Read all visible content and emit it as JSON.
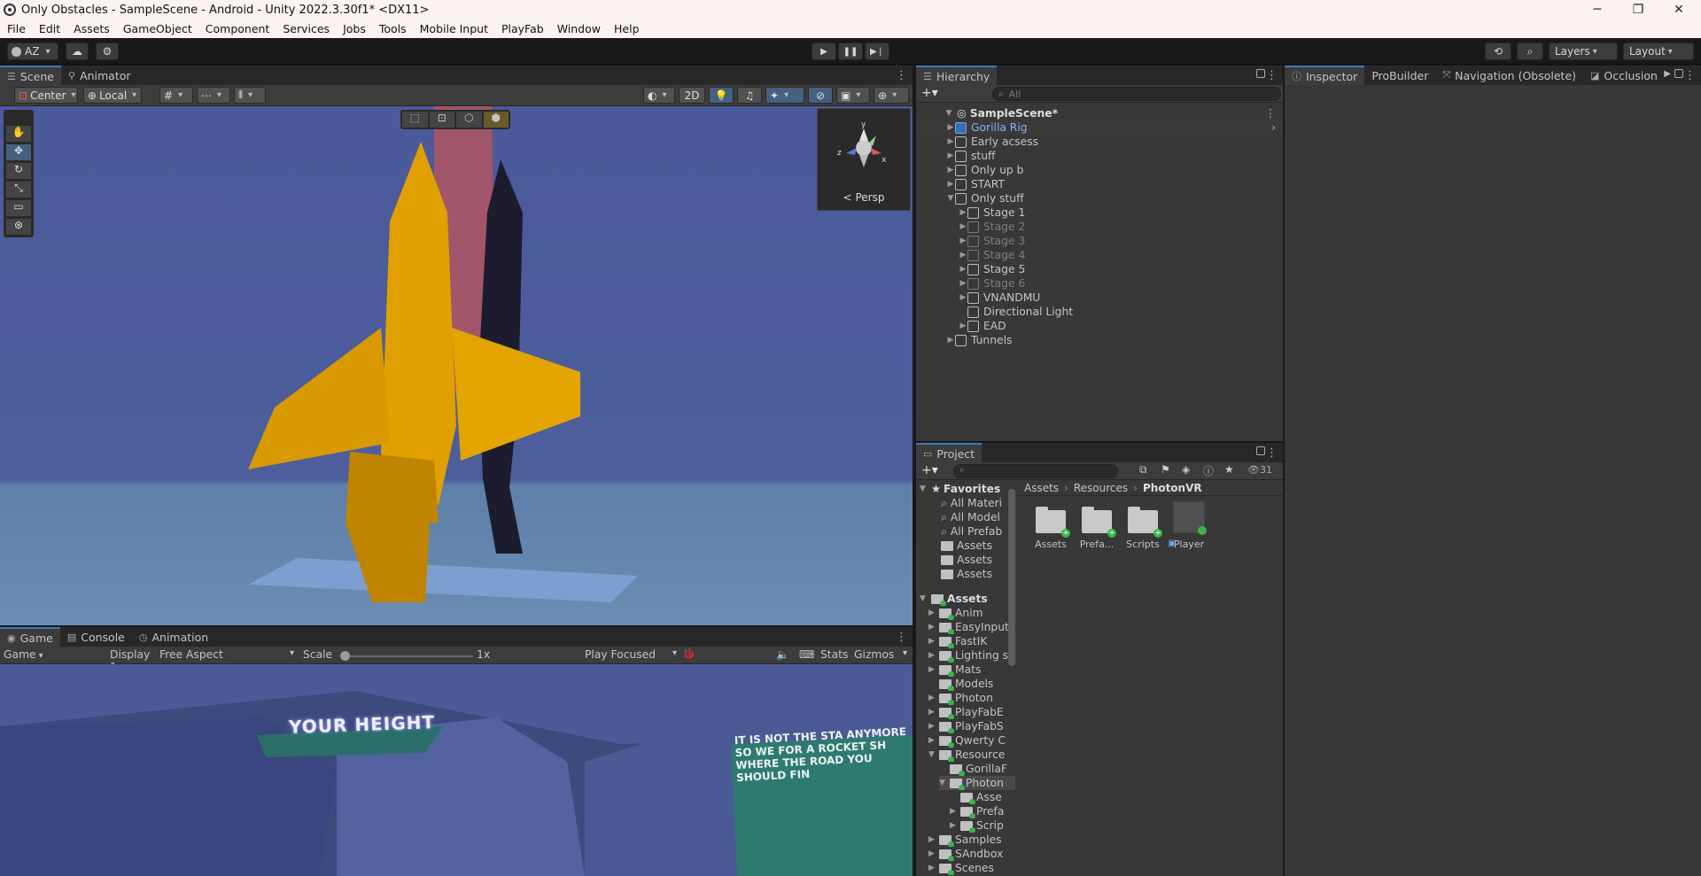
{
  "window": {
    "title": "Only Obstacles - SampleScene - Android - Unity 2022.3.30f1* <DX11>",
    "minimize": "─",
    "maximize": "❐",
    "close": "✕"
  },
  "menu": [
    "File",
    "Edit",
    "Assets",
    "GameObject",
    "Component",
    "Services",
    "Jobs",
    "Tools",
    "Mobile Input",
    "PlayFab",
    "Window",
    "Help"
  ],
  "toolbar": {
    "account": "AZ",
    "layers": "Layers",
    "layout": "Layout"
  },
  "scene_panel": {
    "tabs": [
      "Scene",
      "Animator"
    ],
    "pivot": "Center",
    "space": "Local",
    "mode_2d": "2D",
    "persp": "Persp",
    "gizmo_axes": {
      "y": "y",
      "x": "x",
      "z": "z"
    }
  },
  "game_panel": {
    "tabs": [
      "Game",
      "Console",
      "Animation"
    ],
    "display_mode": "Game",
    "display": "Display 1",
    "aspect": "Free Aspect",
    "scale_label": "Scale",
    "scale_value": "1x",
    "play_mode": "Play Focused",
    "stats": "Stats",
    "gizmos": "Gizmos",
    "scene_text_1": "YOUR HEIGHT",
    "scene_text_2": "IT IS NOT THE STA ANYMORE SO WE FOR A ROCKET SH WHERE THE ROAD YOU SHOULD FIN"
  },
  "hierarchy": {
    "tab": "Hierarchy",
    "search_placeholder": "All",
    "scene": "SampleScene*",
    "items": [
      {
        "label": "Gorilla Rig",
        "depth": 1,
        "arrow": "▶",
        "style": "blue"
      },
      {
        "label": "Early acsess",
        "depth": 1,
        "arrow": "▶",
        "style": ""
      },
      {
        "label": "stuff",
        "depth": 1,
        "arrow": "▶",
        "style": ""
      },
      {
        "label": "Only up b",
        "depth": 1,
        "arrow": "▶",
        "style": ""
      },
      {
        "label": "START",
        "depth": 1,
        "arrow": "▶",
        "style": ""
      },
      {
        "label": "Only stuff",
        "depth": 1,
        "arrow": "▼",
        "style": ""
      },
      {
        "label": "Stage 1",
        "depth": 2,
        "arrow": "▶",
        "style": ""
      },
      {
        "label": "Stage 2",
        "depth": 2,
        "arrow": "▶",
        "style": "dim"
      },
      {
        "label": "Stage 3",
        "depth": 2,
        "arrow": "▶",
        "style": "dim"
      },
      {
        "label": "Stage 4",
        "depth": 2,
        "arrow": "▶",
        "style": "dim"
      },
      {
        "label": "Stage 5",
        "depth": 2,
        "arrow": "▶",
        "style": ""
      },
      {
        "label": "Stage 6",
        "depth": 2,
        "arrow": "▶",
        "style": "dim"
      },
      {
        "label": "VNANDMU",
        "depth": 2,
        "arrow": "▶",
        "style": ""
      },
      {
        "label": "Directional Light",
        "depth": 2,
        "arrow": "",
        "style": ""
      },
      {
        "label": "EAD",
        "depth": 2,
        "arrow": "▶",
        "style": ""
      },
      {
        "label": "Tunnels",
        "depth": 1,
        "arrow": "▶",
        "style": ""
      }
    ]
  },
  "project": {
    "tab": "Project",
    "count": "31",
    "favorites_label": "Favorites",
    "favorites": [
      "All Materi",
      "All Model",
      "All Prefab",
      "Assets",
      "Assets",
      "Assets"
    ],
    "assets_label": "Assets",
    "tree": [
      {
        "label": "Anim",
        "depth": 1,
        "arrow": "▶"
      },
      {
        "label": "EasyInput",
        "depth": 1,
        "arrow": "▶"
      },
      {
        "label": "FastIK",
        "depth": 1,
        "arrow": "▶"
      },
      {
        "label": "Lighting s",
        "depth": 1,
        "arrow": "▶"
      },
      {
        "label": "Mats",
        "depth": 1,
        "arrow": "▶"
      },
      {
        "label": "Models",
        "depth": 1,
        "arrow": ""
      },
      {
        "label": "Photon",
        "depth": 1,
        "arrow": "▶"
      },
      {
        "label": "PlayFabE",
        "depth": 1,
        "arrow": "▶"
      },
      {
        "label": "PlayFabS",
        "depth": 1,
        "arrow": "▶"
      },
      {
        "label": "Qwerty C",
        "depth": 1,
        "arrow": "▶"
      },
      {
        "label": "Resource",
        "depth": 1,
        "arrow": "▼"
      },
      {
        "label": "GorillaF",
        "depth": 2,
        "arrow": ""
      },
      {
        "label": "Photon",
        "depth": 2,
        "arrow": "▼"
      },
      {
        "label": "Asse",
        "depth": 3,
        "arrow": ""
      },
      {
        "label": "Prefa",
        "depth": 3,
        "arrow": "▶"
      },
      {
        "label": "Scrip",
        "depth": 3,
        "arrow": "▶"
      },
      {
        "label": "Samples",
        "depth": 1,
        "arrow": "▶"
      },
      {
        "label": "SAndbox",
        "depth": 1,
        "arrow": "▶"
      },
      {
        "label": "Scenes",
        "depth": 1,
        "arrow": "▶"
      }
    ],
    "breadcrumb": [
      "Assets",
      "Resources",
      "PhotonVR"
    ],
    "grid": [
      {
        "label": "Assets",
        "kind": "folder"
      },
      {
        "label": "Prefa...",
        "kind": "folder"
      },
      {
        "label": "Scripts",
        "kind": "folder"
      },
      {
        "label": "Player",
        "kind": "prefab"
      }
    ]
  },
  "inspector": {
    "tabs": [
      "Inspector",
      "ProBuilder",
      "Navigation (Obsolete)",
      "Occlusion"
    ]
  }
}
